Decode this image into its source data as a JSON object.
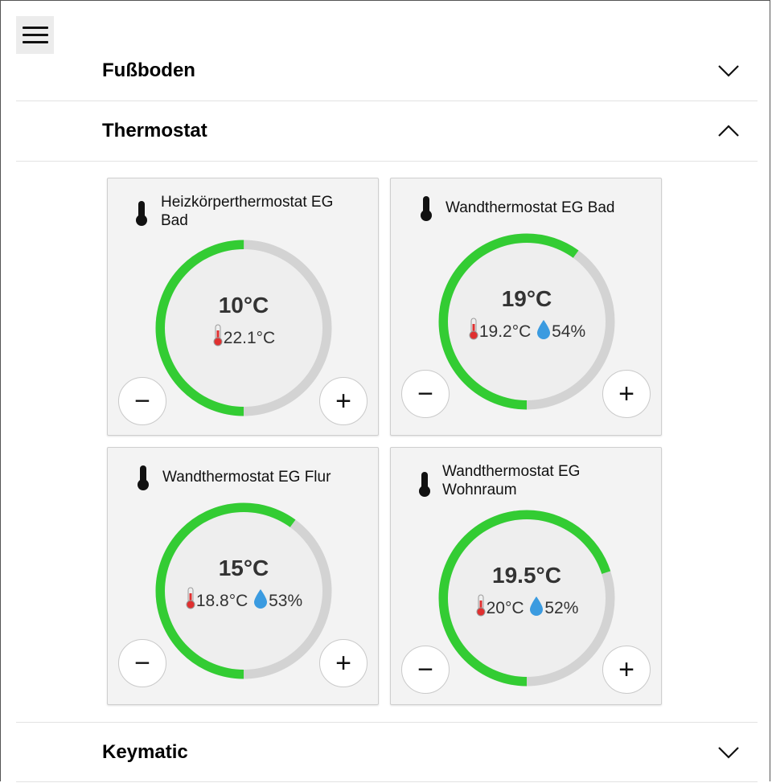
{
  "sections": {
    "fussboden": "Fußboden",
    "thermostat": "Thermostat",
    "keymatic": "Keymatic"
  },
  "controls": {
    "minus": "−",
    "plus": "+"
  },
  "colors": {
    "active_arc": "#33cc33",
    "inactive_arc": "#d3d3d3"
  },
  "cards": [
    {
      "name": "Heizkörperthermostat EG Bad",
      "setpoint": "10°C",
      "temp": "22.1°C",
      "humidity": null,
      "level": 0.5
    },
    {
      "name": "Wandthermostat EG Bad",
      "setpoint": "19°C",
      "temp": "19.2°C",
      "humidity": "54%",
      "level": 0.6
    },
    {
      "name": "Wandthermostat EG Flur",
      "setpoint": "15°C",
      "temp": "18.8°C",
      "humidity": "53%",
      "level": 0.6
    },
    {
      "name": "Wandthermostat EG Wohnraum",
      "setpoint": "19.5°C",
      "temp": "20°C",
      "humidity": "52%",
      "level": 0.7
    }
  ]
}
